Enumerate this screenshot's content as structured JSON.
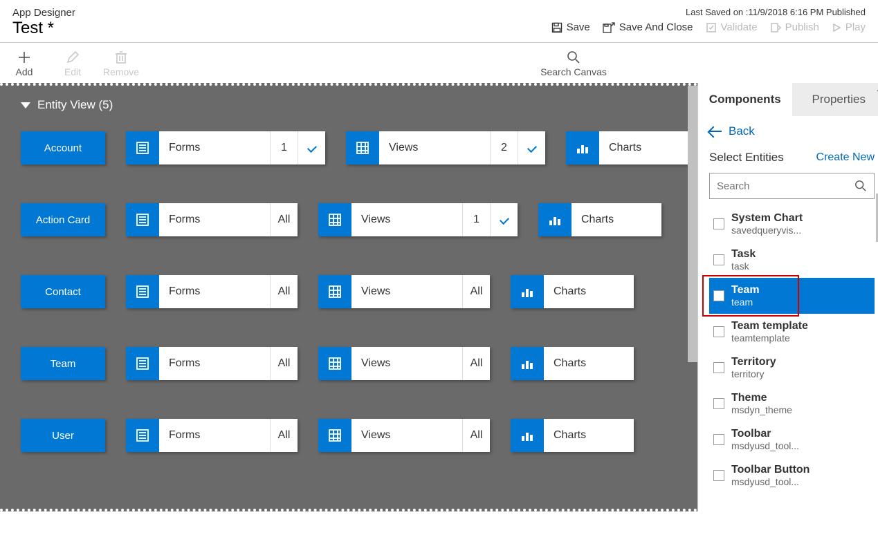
{
  "header": {
    "app_title": "App Designer",
    "app_name": "Test *",
    "status": "Last Saved on :11/9/2018 6:16 PM Published",
    "actions": {
      "save": "Save",
      "save_close": "Save And Close",
      "validate": "Validate",
      "publish": "Publish",
      "play": "Play"
    }
  },
  "toolbar": {
    "add": "Add",
    "edit": "Edit",
    "remove": "Remove",
    "search_canvas": "Search Canvas"
  },
  "canvas": {
    "section_title": "Entity View (5)",
    "labels": {
      "forms": "Forms",
      "views": "Views",
      "charts": "Charts",
      "all": "All"
    },
    "rows": [
      {
        "entity": "Account",
        "forms_count": "1",
        "views_count": "2"
      },
      {
        "entity": "Action Card",
        "forms_count": "All",
        "views_count": "1"
      },
      {
        "entity": "Contact",
        "forms_count": "All",
        "views_count": "All"
      },
      {
        "entity": "Team",
        "forms_count": "All",
        "views_count": "All"
      },
      {
        "entity": "User",
        "forms_count": "All",
        "views_count": "All"
      }
    ]
  },
  "side": {
    "tabs": {
      "components": "Components",
      "properties": "Properties"
    },
    "back": "Back",
    "select_title": "Select Entities",
    "create_new": "Create New",
    "search_placeholder": "Search",
    "entities": [
      {
        "name": "System Chart",
        "sub": "savedqueryvis...",
        "checked": false
      },
      {
        "name": "Task",
        "sub": "task",
        "checked": false
      },
      {
        "name": "Team",
        "sub": "team",
        "checked": true
      },
      {
        "name": "Team template",
        "sub": "teamtemplate",
        "checked": false
      },
      {
        "name": "Territory",
        "sub": "territory",
        "checked": false
      },
      {
        "name": "Theme",
        "sub": "msdyn_theme",
        "checked": false
      },
      {
        "name": "Toolbar",
        "sub": "msdyusd_tool...",
        "checked": false
      },
      {
        "name": "Toolbar Button",
        "sub": "msdyusd_tool...",
        "checked": false
      }
    ]
  }
}
